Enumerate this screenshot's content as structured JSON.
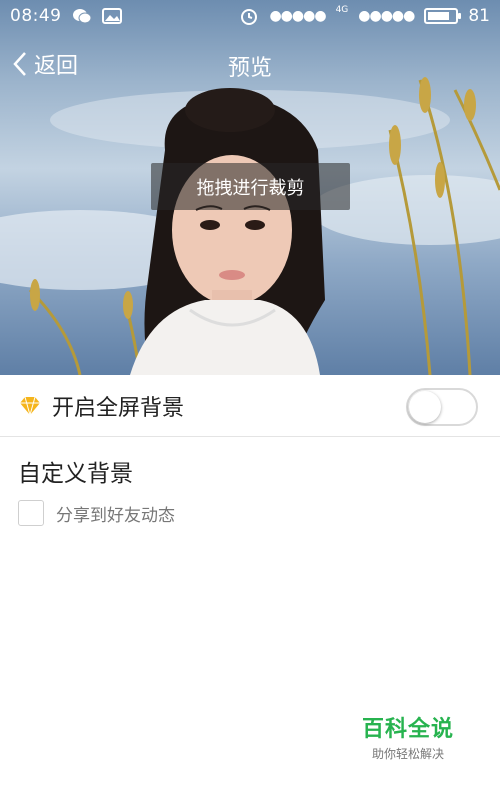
{
  "status_bar": {
    "time": "08:49",
    "icons": [
      "wechat-icon",
      "image-icon"
    ],
    "right_icons": [
      "alarm-icon",
      "signal-icon"
    ],
    "network_type": "4G",
    "battery_level": 81,
    "battery_text": "81"
  },
  "nav": {
    "back_label": "返回",
    "title": "预览"
  },
  "preview": {
    "crop_hint": "拖拽进行裁剪"
  },
  "settings": {
    "fullscreen_label": "开启全屏背景",
    "fullscreen_enabled": false,
    "custom_title": "自定义背景",
    "share_label": "分享到好友动态",
    "share_checked": false
  },
  "watermark": {
    "title": "百科全说",
    "subtitle": "助你轻松解决"
  },
  "colors": {
    "accent_gold": "#f5b51c",
    "watermark_green": "#27b34f"
  }
}
